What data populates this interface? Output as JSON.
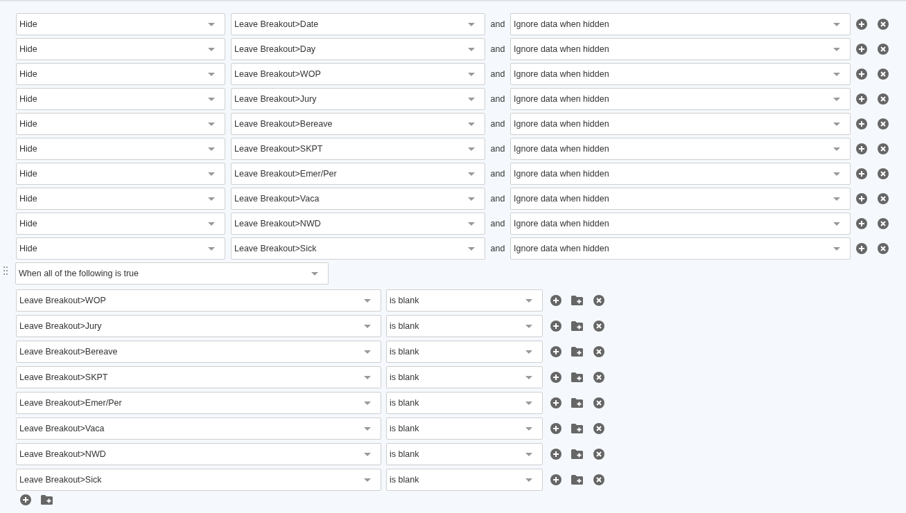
{
  "actions": [
    {
      "action": "Hide",
      "field": "Leave Breakout>Date",
      "joiner": "and",
      "option": "Ignore data when hidden"
    },
    {
      "action": "Hide",
      "field": "Leave Breakout>Day",
      "joiner": "and",
      "option": "Ignore data when hidden"
    },
    {
      "action": "Hide",
      "field": "Leave Breakout>WOP",
      "joiner": "and",
      "option": "Ignore data when hidden"
    },
    {
      "action": "Hide",
      "field": "Leave Breakout>Jury",
      "joiner": "and",
      "option": "Ignore data when hidden"
    },
    {
      "action": "Hide",
      "field": "Leave Breakout>Bereave",
      "joiner": "and",
      "option": "Ignore data when hidden"
    },
    {
      "action": "Hide",
      "field": "Leave Breakout>SKPT",
      "joiner": "and",
      "option": "Ignore data when hidden"
    },
    {
      "action": "Hide",
      "field": "Leave Breakout>Emer/Per",
      "joiner": "and",
      "option": "Ignore data when hidden"
    },
    {
      "action": "Hide",
      "field": "Leave Breakout>Vaca",
      "joiner": "and",
      "option": "Ignore data when hidden"
    },
    {
      "action": "Hide",
      "field": "Leave Breakout>NWD",
      "joiner": "and",
      "option": "Ignore data when hidden"
    },
    {
      "action": "Hide",
      "field": "Leave Breakout>Sick",
      "joiner": "and",
      "option": "Ignore data when hidden"
    }
  ],
  "condition_group": {
    "match": "When all of the following is true",
    "conditions": [
      {
        "field": "Leave Breakout>WOP",
        "operator": "is blank"
      },
      {
        "field": "Leave Breakout>Jury",
        "operator": "is blank"
      },
      {
        "field": "Leave Breakout>Bereave",
        "operator": "is blank"
      },
      {
        "field": "Leave Breakout>SKPT",
        "operator": "is blank"
      },
      {
        "field": "Leave Breakout>Emer/Per",
        "operator": "is blank"
      },
      {
        "field": "Leave Breakout>Vaca",
        "operator": "is blank"
      },
      {
        "field": "Leave Breakout>NWD",
        "operator": "is blank"
      },
      {
        "field": "Leave Breakout>Sick",
        "operator": "is blank"
      }
    ]
  }
}
